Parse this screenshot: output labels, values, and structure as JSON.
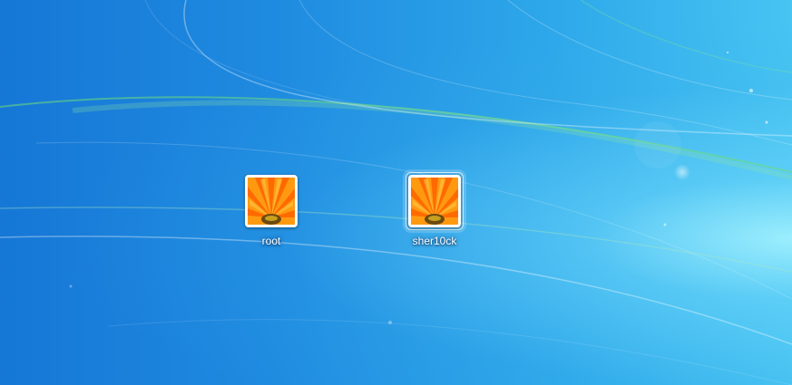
{
  "users": [
    {
      "name": "root",
      "picture": "orange-flower-icon",
      "selected": false
    },
    {
      "name": "sher10ck",
      "picture": "orange-flower-icon",
      "selected": true
    }
  ]
}
